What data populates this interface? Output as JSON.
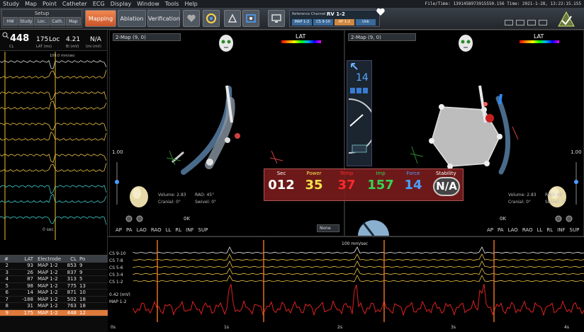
{
  "menu": [
    "Study",
    "Map",
    "Point",
    "Catheter",
    "ECG",
    "Display",
    "Window",
    "Tools",
    "Help"
  ],
  "status_line": "File/Time: 1391458973915550.156 Time: 2021-1-28, 13:22:15.155",
  "toolbar": {
    "setup_label": "Setup",
    "setup_tabs": [
      "HW",
      "Study",
      "Loc.",
      "Cath.",
      "Map"
    ],
    "mode_tabs": [
      {
        "label": "Mapping",
        "active": true
      },
      {
        "label": "Ablation",
        "active": false
      },
      {
        "label": "Verification",
        "active": false
      }
    ],
    "reference_label": "Reference Channel",
    "reference_value": "RV 1-2",
    "reference_cells": [
      "MAP 1-2",
      "CS 9-10",
      "RF 1-2",
      "Unk"
    ],
    "icons": [
      "heart-plus-icon",
      "target-icon",
      "alarm-icon",
      "monitor-icon",
      "window-icon",
      "check-triangle-icon"
    ]
  },
  "vitals": {
    "hr": "448",
    "hr_label": "CL",
    "loc": "175",
    "loc_label": "Loc",
    "lat_label": "LAT (ms)",
    "ri": "4.21",
    "ri_label": "Bi (mV)",
    "uni": "N/A",
    "uni_label": "Uni (mV)"
  },
  "ecg": {
    "scale_label": "100.0 mm/sec",
    "time_label": "0 sec"
  },
  "point_table": {
    "headers": [
      "#",
      "LAT",
      "Electrode",
      "CL",
      "Po"
    ],
    "rows": [
      {
        "n": "2",
        "lat": "93",
        "el": "MAP 1-2",
        "cl": "853",
        "po": "9"
      },
      {
        "n": "3",
        "lat": "26",
        "el": "MAP 1-2",
        "cl": "837",
        "po": "9"
      },
      {
        "n": "4",
        "lat": "87",
        "el": "MAP 1-2",
        "cl": "313",
        "po": "5"
      },
      {
        "n": "5",
        "lat": "98",
        "el": "MAP 1-2",
        "cl": "775",
        "po": "13"
      },
      {
        "n": "6",
        "lat": "14",
        "el": "MAP 1-2",
        "cl": "871",
        "po": "10"
      },
      {
        "n": "7",
        "lat": "-188",
        "el": "MAP 1-2",
        "cl": "502",
        "po": "18"
      },
      {
        "n": "8",
        "lat": "31",
        "el": "MAP 1-2",
        "cl": "763",
        "po": "18"
      },
      {
        "n": "9",
        "lat": "175",
        "el": "MAP 1-2",
        "cl": "448",
        "po": "12",
        "selected": true
      }
    ]
  },
  "map_left": {
    "dropdown": "2-Map (9, 0)",
    "lat_label": "LAT",
    "scale": "1.00",
    "volume": "Volume: 2.83",
    "rao": "RAO: 45°",
    "cranial": "Cranial: 0°",
    "swivel": "Swivel: 0°",
    "ok_label": "0K",
    "none_label": "None",
    "view_buttons": [
      "AP",
      "PA",
      "LAO",
      "RAO",
      "LL",
      "RL",
      "INF",
      "SUP"
    ]
  },
  "map_right": {
    "dropdown": "2-Map (9, 0)",
    "lat_label": "LAT",
    "scale": "1.00",
    "force_num": "14",
    "volume": "Volume: 2.83",
    "rao": "RAO: 45°",
    "cranial": "Cranial: 0°",
    "swivel": "Swivel: 0°",
    "ok_label": "0K",
    "view_buttons": [
      "AP",
      "PA",
      "LAO",
      "RAO",
      "LL",
      "RL",
      "INF",
      "SUP"
    ]
  },
  "ablation": {
    "sec_label": "Sec",
    "sec": "012",
    "power_label": "Power",
    "power": "35",
    "temp_label": "Temp",
    "temp": "37",
    "imp_label": "Imp",
    "imp": "157",
    "force_label": "Force",
    "force": "14",
    "stability_label": "Stability",
    "stability": "N/A",
    "colors": {
      "sec": "#ffffff",
      "power": "#f5e64a",
      "temp": "#ff2a2a",
      "imp": "#35d455",
      "force": "#4aa0ff"
    }
  },
  "traces": {
    "scale_label": "100 mm/sec",
    "channels": [
      "CS 9-10",
      "CS 7-8",
      "CS 5-6",
      "CS 3-4",
      "CS 1-2",
      "0.42 (mV)",
      "MAP 1-2"
    ],
    "time_ticks": [
      "0s",
      "1s",
      "2s",
      "3s",
      "4s"
    ]
  }
}
